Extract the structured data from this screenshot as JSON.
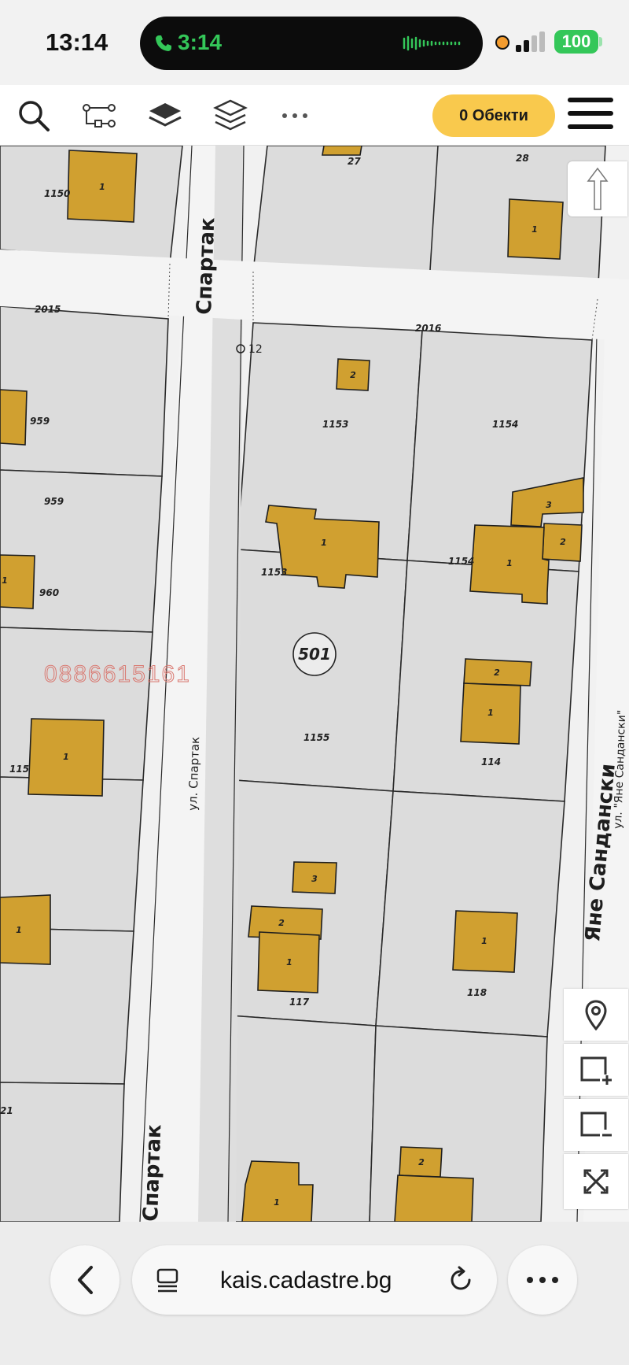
{
  "status_bar": {
    "time": "13:14",
    "call_duration": "3:14",
    "battery": "100"
  },
  "toolbar": {
    "objects_button": "0 Обекти",
    "icons": [
      "search-icon",
      "route-icon",
      "layer-filled-icon",
      "layers-icon",
      "more-icon",
      "menu-icon"
    ]
  },
  "map": {
    "streets": {
      "spartak_top": "Спартак",
      "spartak_mid": "ул. Спартак",
      "spartak_bottom": "Спартак",
      "sandanski_big": "Яне Сандански",
      "sandanski_small": "ул. \"Яне Сандански\""
    },
    "block_number": "501",
    "watermark_phone": "0886615161",
    "labels": {
      "p1150": "1150",
      "p27": "27",
      "p28": "28",
      "p2015": "2015",
      "p2016": "2016",
      "pt12": "12",
      "p959a": "959",
      "p959b": "959",
      "p960": "960",
      "p1153": "1153",
      "p1153b": "1153",
      "p1154": "1154",
      "p1154b": "1154",
      "p1155": "1155",
      "p114": "114",
      "p115": "115",
      "p117": "117",
      "p118": "118",
      "p21": "21",
      "b1": "1",
      "b2": "2",
      "b3": "3"
    },
    "colors": {
      "parcel": "#dcdcdc",
      "building": "#d0a030",
      "road": "#f4f4f4"
    }
  },
  "browser": {
    "url": "kais.cadastre.bg"
  }
}
